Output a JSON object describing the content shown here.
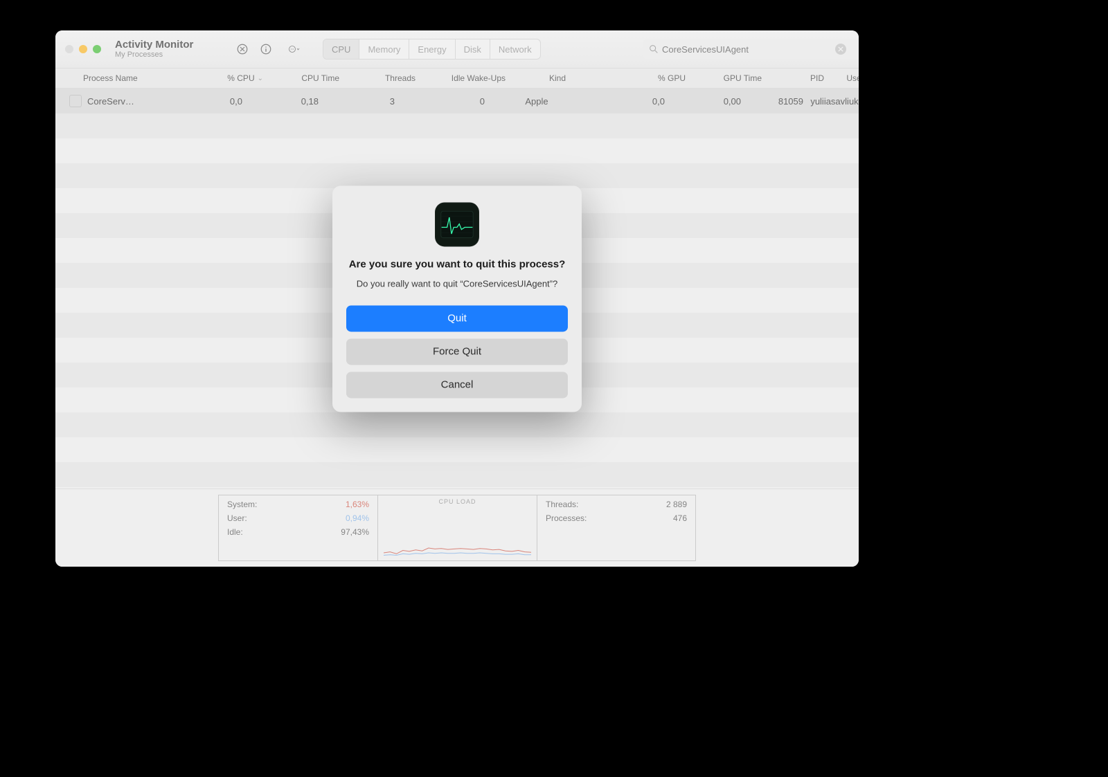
{
  "window": {
    "title": "Activity Monitor",
    "subtitle": "My Processes"
  },
  "toolbar": {
    "tabs": {
      "cpu": "CPU",
      "memory": "Memory",
      "energy": "Energy",
      "disk": "Disk",
      "network": "Network",
      "active": "cpu"
    },
    "search": {
      "value": "CoreServicesUIAgent"
    }
  },
  "columns": {
    "process_name": "Process Name",
    "pct_cpu": "% CPU",
    "cpu_time": "CPU Time",
    "threads": "Threads",
    "idle_wakeups": "Idle Wake-Ups",
    "kind": "Kind",
    "pct_gpu": "% GPU",
    "gpu_time": "GPU Time",
    "pid": "PID",
    "user": "User"
  },
  "rows": [
    {
      "name": "CoreServ…",
      "pct_cpu": "0,0",
      "cpu_time": "0,18",
      "threads": "3",
      "idle_wakeups": "0",
      "kind": "Apple",
      "pct_gpu": "0,0",
      "gpu_time": "0,00",
      "pid": "81059",
      "user": "yuliiasavliuk"
    }
  ],
  "footer": {
    "left": {
      "system_label": "System:",
      "system_value": "1,63%",
      "user_label": "User:",
      "user_value": "0,94%",
      "idle_label": "Idle:",
      "idle_value": "97,43%"
    },
    "chart_label": "CPU LOAD",
    "right": {
      "threads_label": "Threads:",
      "threads_value": "2 889",
      "processes_label": "Processes:",
      "processes_value": "476"
    }
  },
  "dialog": {
    "title": "Are you sure you want to quit this process?",
    "message": "Do you really want to quit “CoreServicesUIAgent”?",
    "quit": "Quit",
    "force_quit": "Force Quit",
    "cancel": "Cancel"
  },
  "chart_data": {
    "type": "area",
    "title": "CPU LOAD",
    "xlabel": "",
    "ylabel": "",
    "ylim": [
      0,
      10
    ],
    "series": [
      {
        "name": "System",
        "color": "#d16a5d",
        "values": [
          1.0,
          1.2,
          0.8,
          1.5,
          1.3,
          1.6,
          1.4,
          2.0,
          1.8,
          1.9,
          1.7,
          1.8,
          1.9,
          1.8,
          1.7,
          1.9,
          1.8,
          1.6,
          1.7,
          1.4,
          1.3,
          1.5,
          1.2,
          1.1
        ]
      },
      {
        "name": "User",
        "color": "#8bb6e6",
        "values": [
          0.5,
          0.6,
          0.5,
          0.8,
          0.7,
          0.9,
          0.8,
          1.0,
          0.9,
          1.0,
          0.9,
          0.9,
          1.0,
          0.9,
          0.9,
          1.0,
          0.9,
          0.8,
          0.8,
          0.7,
          0.7,
          0.8,
          0.6,
          0.6
        ]
      }
    ]
  }
}
